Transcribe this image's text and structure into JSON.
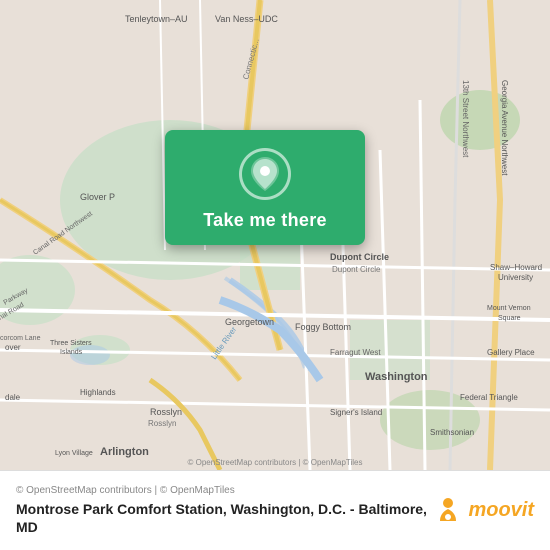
{
  "map": {
    "alt": "Map of Washington DC area",
    "center_lat": 38.92,
    "center_lng": -77.06
  },
  "button": {
    "label": "Take me there",
    "icon": "location-pin-icon"
  },
  "bottom_bar": {
    "copyright": "© OpenStreetMap contributors | © OpenMapTiles",
    "location_title": "Montrose Park Comfort Station, Washington, D.C. - Baltimore, MD",
    "moovit_brand": "moovit"
  }
}
